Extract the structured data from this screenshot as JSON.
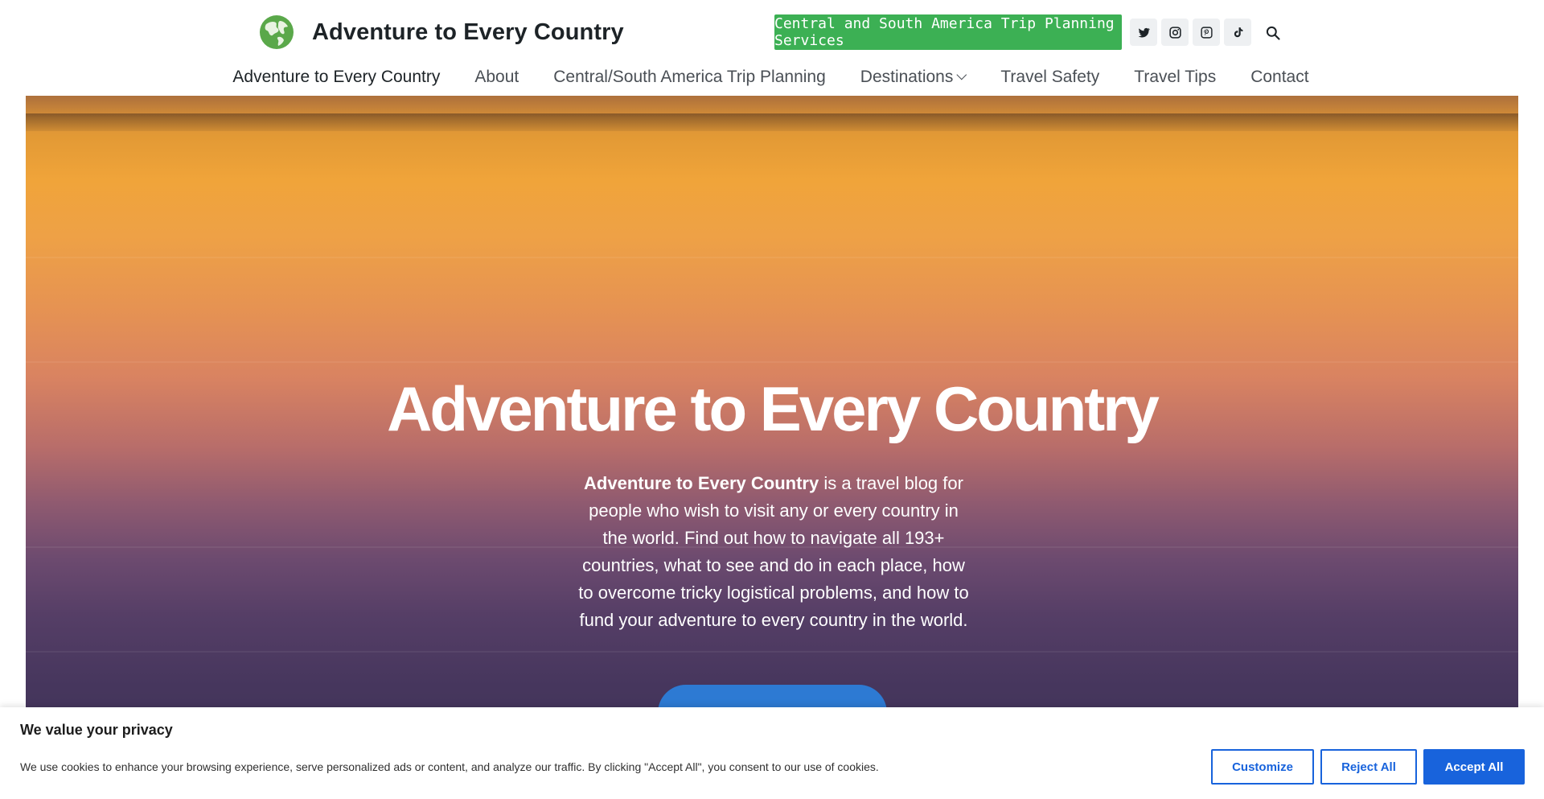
{
  "header": {
    "site_title": "Adventure to Every Country",
    "cta_label": "Central and South America Trip Planning Services",
    "socials": [
      {
        "icon": "twitter-icon"
      },
      {
        "icon": "instagram-icon"
      },
      {
        "icon": "pinterest-icon"
      },
      {
        "icon": "tiktok-icon"
      }
    ],
    "search_icon": "search-icon"
  },
  "nav": {
    "items": [
      {
        "label": "Adventure to Every Country"
      },
      {
        "label": "About"
      },
      {
        "label": "Central/South America Trip Planning"
      },
      {
        "label": "Destinations"
      },
      {
        "label": "Travel Safety"
      },
      {
        "label": "Travel Tips"
      },
      {
        "label": "Contact"
      }
    ]
  },
  "hero": {
    "title": "Adventure to Every Country",
    "desc_bold": "Adventure to Every Country",
    "desc_rest": " is a travel blog for people who wish to visit any or every country in the world. Find out how to navigate all 193+ countries, what to see and do in each place, how to overcome tricky logistical problems, and how to fund your adventure to every country in the world."
  },
  "cookie": {
    "title": "We value your privacy",
    "text": "We use cookies to enhance your browsing experience, serve personalized ads or content, and analyze our traffic. By clicking \"Accept All\", you consent to our use of cookies.",
    "customize_label": "Customize",
    "reject_label": "Reject All",
    "accept_label": "Accept All"
  },
  "colors": {
    "cta_green": "#3cb054",
    "primary_blue": "#1863dc",
    "hero_button_blue": "#2d7ad3"
  }
}
